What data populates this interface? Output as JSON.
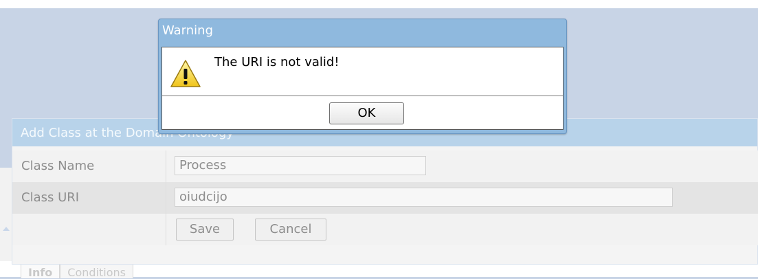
{
  "background": {
    "tabs": [
      {
        "label": "Info"
      },
      {
        "label": "Conditions"
      }
    ]
  },
  "add_class_dialog": {
    "title": "Add Class at the Domain Ontology",
    "class_name_label": "Class Name",
    "class_name_value": "Process",
    "class_uri_label": "Class URI",
    "class_uri_value": "oiudcijo",
    "save_label": "Save",
    "cancel_label": "Cancel"
  },
  "warning_dialog": {
    "title": "Warning",
    "message": "The URI is not valid!",
    "ok_label": "OK",
    "icon": "warning-icon"
  },
  "colors": {
    "dialog_title_bar": "#8fb9de",
    "page_background": "#c8d4e6"
  }
}
